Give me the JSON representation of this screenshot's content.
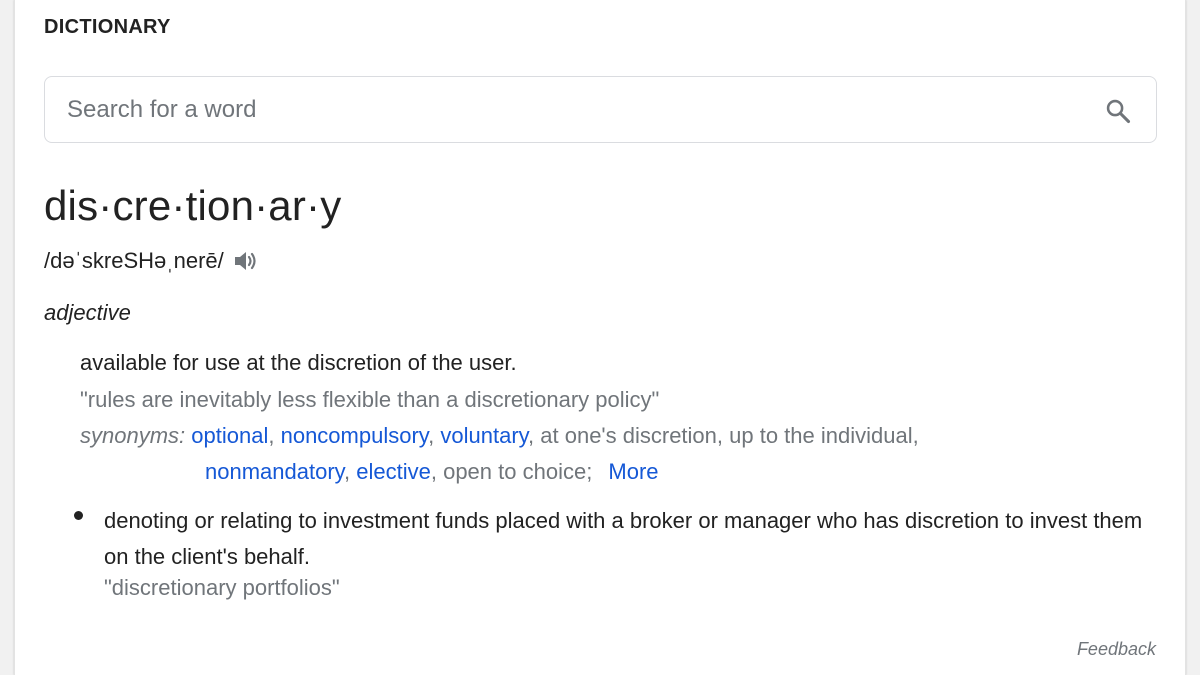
{
  "section_title": "DICTIONARY",
  "search": {
    "placeholder": "Search for a word",
    "value": ""
  },
  "entry": {
    "headword": "dis·cre·tion·ar·y",
    "pronunciation": "/dəˈskreSHəˌnerē/",
    "part_of_speech": "adjective",
    "senses": [
      {
        "definition": "available for use at the discretion of the user.",
        "example": "\"rules are inevitably less flexible than a discretionary policy\"",
        "synonyms_label": "synonyms:",
        "synonyms": {
          "optional": "optional",
          "noncompulsory": "noncompulsory",
          "voluntary": "voluntary",
          "at_ones_discretion": "at one's discretion",
          "up_to_the_individual": "up to the individual",
          "nonmandatory": "nonmandatory",
          "elective": "elective",
          "open_to_choice": "open to choice"
        },
        "more_label": "More"
      },
      {
        "definition": "denoting or relating to investment funds placed with a broker or manager who has discretion to invest them on the client's behalf.",
        "example": "\"discretionary portfolios\""
      }
    ]
  },
  "feedback_label": "Feedback",
  "icons": {
    "search": "search-icon",
    "speaker": "speaker-icon"
  },
  "colors": {
    "link": "#1558d6",
    "muted": "#70757a",
    "text": "#222222"
  }
}
